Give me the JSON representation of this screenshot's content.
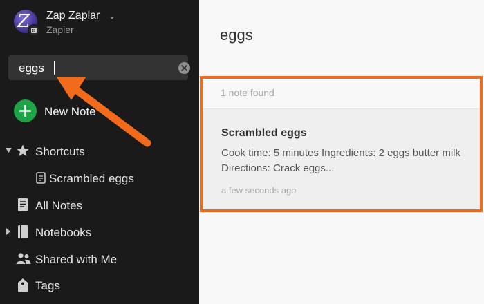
{
  "user": {
    "name": "Zap Zaplar",
    "org": "Zapier",
    "avatar_letter": "Z"
  },
  "search": {
    "value": "eggs"
  },
  "sidebar": {
    "new_note_label": "New Note",
    "items": [
      {
        "label": "Shortcuts",
        "icon": "star-icon"
      },
      {
        "label": "Scrambled eggs",
        "icon": "note-icon"
      },
      {
        "label": "All Notes",
        "icon": "notes-stack-icon"
      },
      {
        "label": "Notebooks",
        "icon": "notebook-icon"
      },
      {
        "label": "Shared with Me",
        "icon": "people-icon"
      },
      {
        "label": "Tags",
        "icon": "tag-icon"
      }
    ]
  },
  "main": {
    "title": "eggs",
    "results_count": "1 note found",
    "note": {
      "title": "Scrambled eggs",
      "snippet": "Cook time: 5 minutes Ingredients: 2 eggs butter milk Directions: Crack eggs...",
      "time": "a few seconds ago"
    }
  },
  "colors": {
    "sidebar_bg": "#1a1a1a",
    "accent_green": "#1ea446",
    "highlight_orange": "#f26b1d"
  }
}
